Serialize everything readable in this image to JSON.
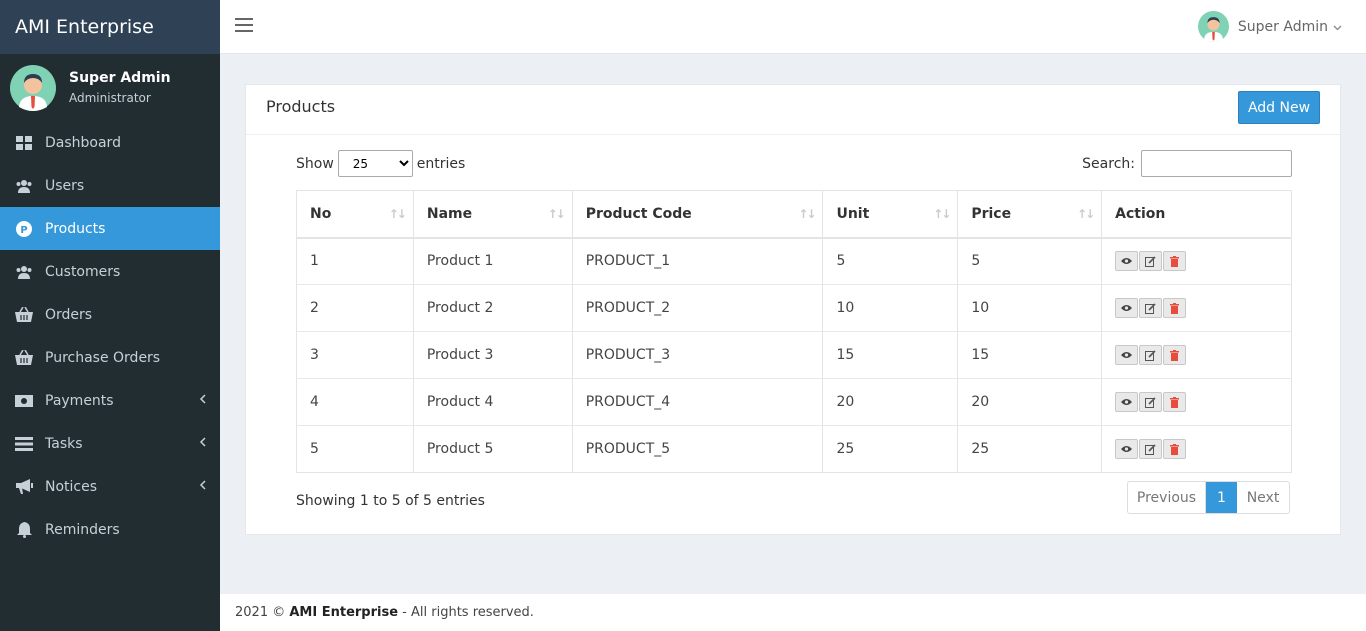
{
  "app": {
    "title": "AMI Enterprise"
  },
  "user": {
    "name": "Super Admin",
    "role": "Administrator"
  },
  "sidebar": {
    "items": [
      {
        "label": "Dashboard",
        "icon": "dashboard-icon",
        "active": false,
        "has_children": false
      },
      {
        "label": "Users",
        "icon": "users-icon",
        "active": false,
        "has_children": false
      },
      {
        "label": "Products",
        "icon": "product-icon",
        "active": true,
        "has_children": false
      },
      {
        "label": "Customers",
        "icon": "customers-icon",
        "active": false,
        "has_children": false
      },
      {
        "label": "Orders",
        "icon": "basket-icon",
        "active": false,
        "has_children": false
      },
      {
        "label": "Purchase Orders",
        "icon": "basket-icon",
        "active": false,
        "has_children": false
      },
      {
        "label": "Payments",
        "icon": "money-icon",
        "active": false,
        "has_children": true
      },
      {
        "label": "Tasks",
        "icon": "tasks-icon",
        "active": false,
        "has_children": true
      },
      {
        "label": "Notices",
        "icon": "megaphone-icon",
        "active": false,
        "has_children": true
      },
      {
        "label": "Reminders",
        "icon": "bell-icon",
        "active": false,
        "has_children": false
      }
    ]
  },
  "topbar": {
    "user_name": "Super Admin"
  },
  "card": {
    "title": "Products",
    "add_button": "Add New",
    "show_label": "Show",
    "entries_label": "entries",
    "page_size": "25",
    "search_label": "Search:",
    "search_value": ""
  },
  "table": {
    "columns": [
      "No",
      "Name",
      "Product Code",
      "Unit",
      "Price",
      "Action"
    ],
    "rows": [
      [
        "1",
        "Product 1",
        "PRODUCT_1",
        "5",
        "5"
      ],
      [
        "2",
        "Product 2",
        "PRODUCT_2",
        "10",
        "10"
      ],
      [
        "3",
        "Product 3",
        "PRODUCT_3",
        "15",
        "15"
      ],
      [
        "4",
        "Product 4",
        "PRODUCT_4",
        "20",
        "20"
      ],
      [
        "5",
        "Product 5",
        "PRODUCT_5",
        "25",
        "25"
      ]
    ]
  },
  "pagination": {
    "info": "Showing 1 to 5 of 5 entries",
    "previous": "Previous",
    "current": "1",
    "next": "Next"
  },
  "footer": {
    "year": "2021 ©",
    "company": "AMI Enterprise",
    "rights": "- All rights reserved."
  },
  "colors": {
    "sidebar": "#222d32",
    "brand": "#2e4155",
    "accent": "#3498db",
    "delete": "#e74c3c"
  }
}
